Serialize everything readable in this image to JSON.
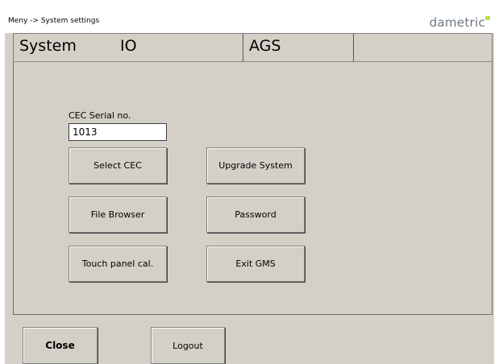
{
  "header": {
    "breadcrumb": "Meny -> System settings",
    "brand": "dametric"
  },
  "tabs": [
    {
      "label": "System"
    },
    {
      "label": "IO"
    },
    {
      "label": "AGS"
    },
    {
      "label": ""
    }
  ],
  "panel": {
    "serial_label": "CEC Serial no.",
    "serial_value": "1013",
    "buttons": {
      "select_cec": "Select CEC",
      "upgrade_system": "Upgrade System",
      "file_browser": "File Browser",
      "password": "Password",
      "touch_panel_cal": "Touch panel cal.",
      "exit_gms": "Exit GMS"
    }
  },
  "footer": {
    "close": "Close",
    "logout": "Logout"
  },
  "colors": {
    "background": "#d4d0c8",
    "brand_text": "#6c7680",
    "brand_mark": "#b7e04c"
  }
}
